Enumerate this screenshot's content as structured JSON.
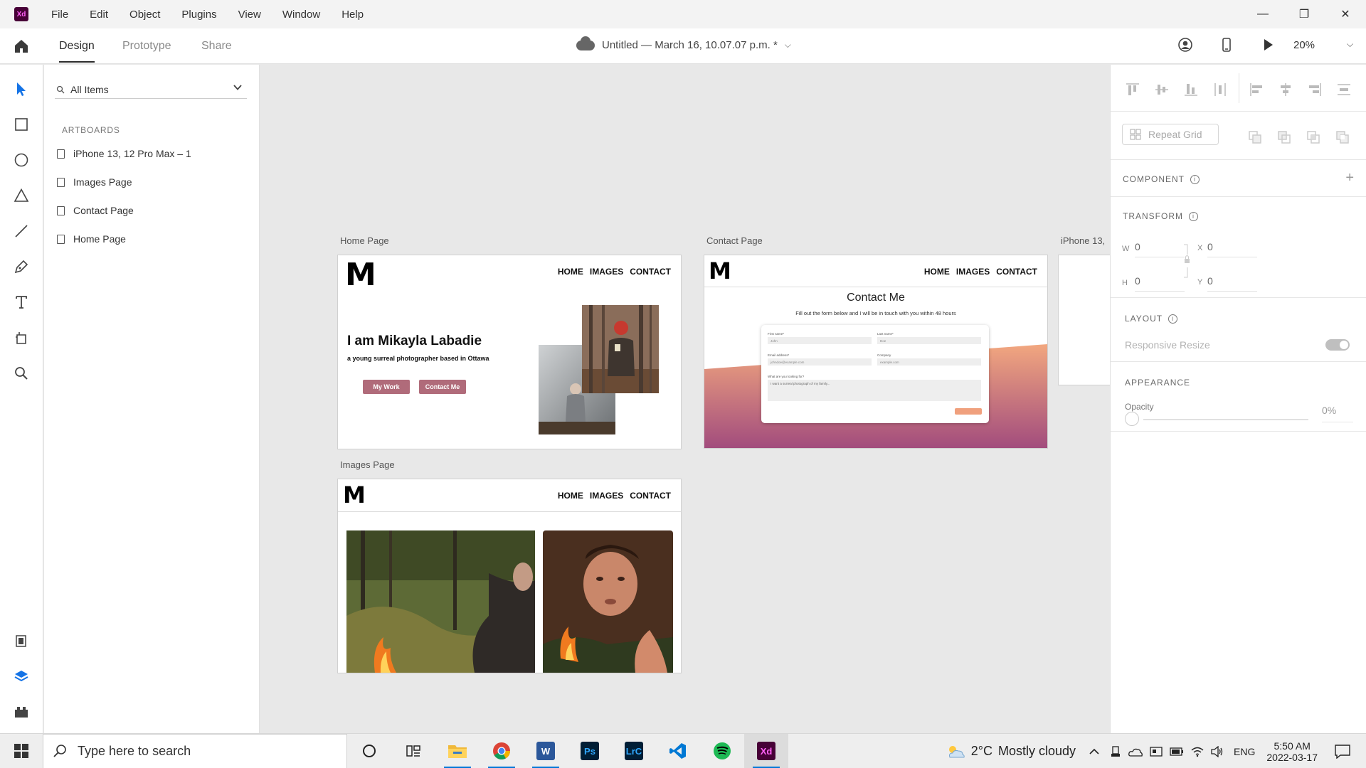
{
  "app": {
    "logo": "Xd",
    "menu": [
      "File",
      "Edit",
      "Object",
      "Plugins",
      "View",
      "Window",
      "Help"
    ],
    "window_controls": {
      "minimize": "—",
      "restore": "❐",
      "close": "✕"
    }
  },
  "tabbar": {
    "tabs": [
      "Design",
      "Prototype",
      "Share"
    ],
    "active_tab": "Design",
    "doc_title": "Untitled — March 16, 10.07.07 p.m. *",
    "zoom": "20%"
  },
  "layers": {
    "search": "All Items",
    "section": "ARTBOARDS",
    "artboards": [
      "iPhone 13, 12 Pro Max – 1",
      "Images Page",
      "Contact Page",
      "Home Page"
    ]
  },
  "canvas": {
    "home": {
      "label": "Home Page",
      "logo": "M",
      "nav": [
        "HOME",
        "IMAGES",
        "CONTACT"
      ],
      "heading": "I am Mikayla Labadie",
      "subheading": "a young surreal photographer based in Ottawa",
      "buttons": [
        "My Work",
        "Contact Me"
      ]
    },
    "contact": {
      "label": "Contact Page",
      "logo": "M",
      "nav": [
        "HOME",
        "IMAGES",
        "CONTACT"
      ],
      "heading": "Contact Me",
      "subheading": "Fill out the form below and I will be in touch with you within 48 hours",
      "fields": [
        {
          "label": "First name*",
          "value": "John"
        },
        {
          "label": "Last name*",
          "value": "Doe"
        },
        {
          "label": "Email address*",
          "value": "johndoe@example.com"
        },
        {
          "label": "Company",
          "value": "example.com"
        }
      ],
      "message_label": "What are you looking for?",
      "message_value": "I want a surreal photograph of my family..."
    },
    "images": {
      "label": "Images Page",
      "logo": "M",
      "nav": [
        "HOME",
        "IMAGES",
        "CONTACT"
      ]
    },
    "iphone": {
      "label": "iPhone 13,"
    }
  },
  "props": {
    "repeat_grid": "Repeat Grid",
    "component": "COMPONENT",
    "transform": "TRANSFORM",
    "w_label": "W",
    "w": "0",
    "x_label": "X",
    "x": "0",
    "h_label": "H",
    "h": "0",
    "y_label": "Y",
    "y": "0",
    "layout": "LAYOUT",
    "responsive_resize": "Responsive Resize",
    "appearance": "APPEARANCE",
    "opacity_label": "Opacity",
    "opacity": "0%",
    "plus": "+"
  },
  "taskbar": {
    "search_placeholder": "Type here to search",
    "apps": [
      "Cortana",
      "Task View",
      "File Explorer",
      "Chrome",
      "Word",
      "Photoshop",
      "Lightroom Classic",
      "VS Code",
      "Spotify",
      "Adobe XD"
    ],
    "weather_temp": "2°C",
    "weather_desc": "Mostly cloudy",
    "lang": "ENG",
    "time": "5:50 AM",
    "date": "2022-03-17"
  },
  "colors": {
    "xd_brand": "#470137",
    "xd_pink": "#ff61f6",
    "accent_blue": "#1473e6",
    "button_mauve": "#b06b7a",
    "taskbar_active": "#0078d7"
  },
  "icons": [
    "home-icon",
    "select-icon",
    "rectangle-icon",
    "ellipse-icon",
    "triangle-icon",
    "line-icon",
    "pen-icon",
    "text-icon",
    "artboard-icon",
    "zoom-icon",
    "assets-icon",
    "layers-icon",
    "plugins-icon",
    "share-user-icon",
    "device-preview-icon",
    "play-icon"
  ]
}
